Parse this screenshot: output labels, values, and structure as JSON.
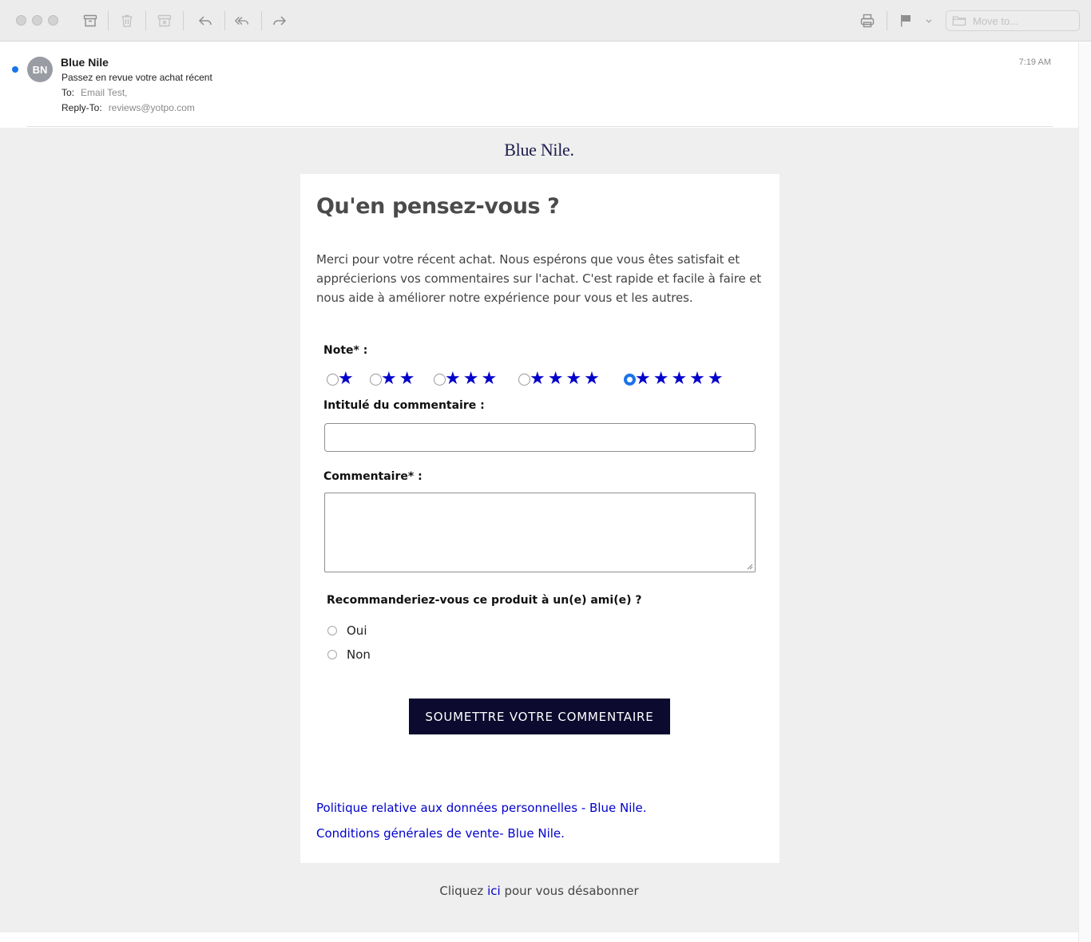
{
  "toolbar": {
    "move_to_placeholder": "Move to..."
  },
  "message": {
    "avatar_initials": "BN",
    "sender": "Blue Nile",
    "subject": "Passez en revue votre achat récent",
    "to_label": "To:",
    "to_value": "Email Test,",
    "reply_to_label": "Reply-To:",
    "reply_to_value": "reviews@yotpo.com",
    "time": "7:19 AM"
  },
  "email": {
    "logo": "Blue Nile.",
    "title": "Qu'en pensez-vous ?",
    "intro": "Merci pour votre récent achat. Nous espérons que vous êtes satisfait et apprécierions vos commentaires sur l'achat. C'est rapide et facile à faire et nous aide à améliorer notre expérience pour vous et les autres.",
    "rating_label": "Note* :",
    "rating_options": [
      {
        "stars": "★",
        "checked": false
      },
      {
        "stars": "★★",
        "checked": false
      },
      {
        "stars": "★★★",
        "checked": false
      },
      {
        "stars": "★★★★",
        "checked": false
      },
      {
        "stars": "★★★★★",
        "checked": true
      }
    ],
    "selected_rating": 5,
    "comment_title_label": "Intitulé du commentaire :",
    "comment_title_value": "",
    "comment_label": "Commentaire* :",
    "comment_value": "",
    "recommend_question": "Recommanderiez-vous ce produit à un(e) ami(e) ?",
    "recommend_yes": "Oui",
    "recommend_no": "Non",
    "submit_label": "SOUMETTRE VOTRE COMMENTAIRE",
    "privacy_link": "Politique relative aux données personnelles - Blue Nile.",
    "terms_link": "Conditions générales de vente- Blue Nile.",
    "unsubscribe_prefix": "Cliquez",
    "unsubscribe_link": "ici",
    "unsubscribe_suffix": "pour vous désabonner"
  },
  "colors": {
    "accent": "#0000cc",
    "button": "#0c0a2e",
    "unread": "#1a73e8",
    "background": "#efefef"
  }
}
